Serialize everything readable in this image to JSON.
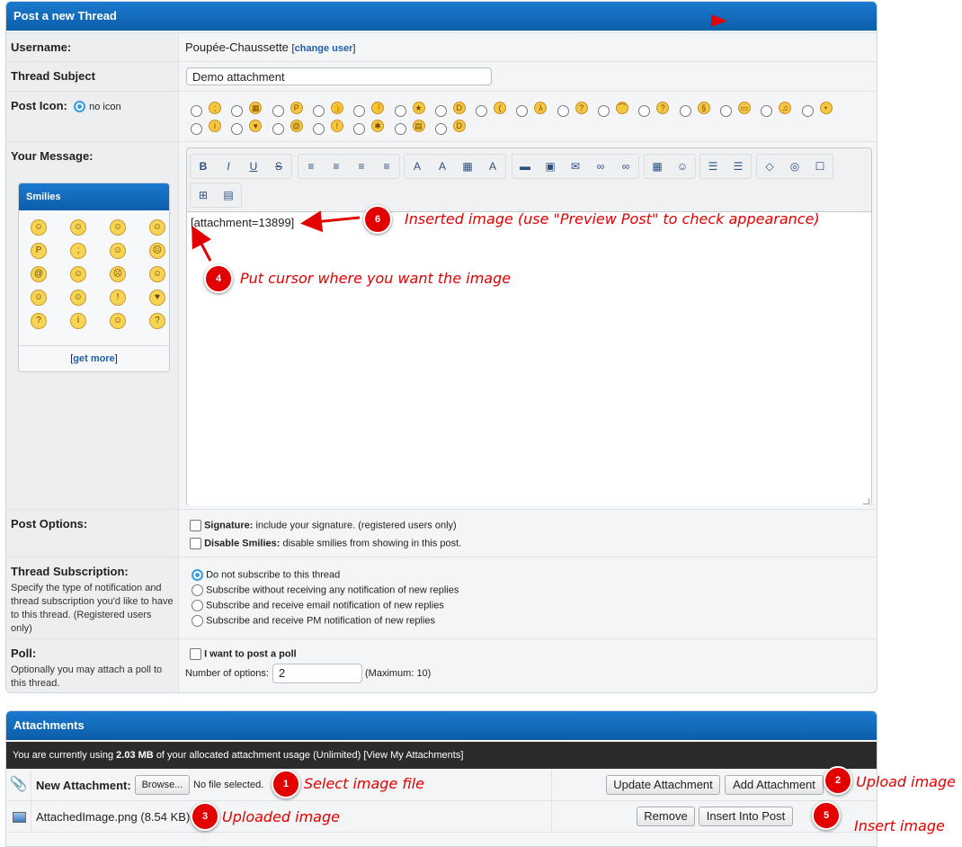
{
  "post_panel": {
    "title": "Post a new Thread",
    "username_label": "Username:",
    "username_value": "Poupée-Chaussette",
    "change_user_open": "[",
    "change_user_link": "change user",
    "change_user_close": "]",
    "subject_label": "Thread Subject",
    "subject_value": "Demo attachment",
    "post_icon_label": "Post Icon:",
    "no_icon_label": "no icon",
    "message_label": "Your Message:",
    "message_text": "[attachment=13899]",
    "smilies_title": "Smilies",
    "get_more_open": "[",
    "get_more_link": "get more",
    "get_more_close": "]",
    "post_options_label": "Post Options:",
    "signature_bold": "Signature:",
    "signature_text": "include your signature. (registered users only)",
    "disable_smilies_bold": "Disable Smilies:",
    "disable_smilies_text": "disable smilies from showing in this post.",
    "subscription_label": "Thread Subscription:",
    "subscription_desc": "Specify the type of notification and thread subscription you'd like to have to this thread. (Registered users only)",
    "subscription_options": [
      "Do not subscribe to this thread",
      "Subscribe without receiving any notification of new replies",
      "Subscribe and receive email notification of new replies",
      "Subscribe and receive PM notification of new replies"
    ],
    "poll_label": "Poll:",
    "poll_desc": "Optionally you may attach a poll to this thread.",
    "poll_checkbox": "I want to post a poll",
    "num_options_label": "Number of options:",
    "num_options_value": "2",
    "num_options_max": "(Maximum: 10)"
  },
  "attachments_panel": {
    "title": "Attachments",
    "usage_prefix": "You are currently using",
    "usage_amount": "2.03 MB",
    "usage_suffix": "of your allocated attachment usage (Unlimited)",
    "view_link": "[View My Attachments]",
    "new_attachment_label": "New Attachment:",
    "browse_button": "Browse...",
    "no_file": "No file selected.",
    "update_button": "Update Attachment",
    "add_button": "Add Attachment",
    "file_name": "AttachedImage.png (8.54 KB)",
    "remove_button": "Remove",
    "insert_button": "Insert Into Post"
  },
  "annotations": {
    "n1": "1",
    "t1": "Select image file",
    "n2": "2",
    "t2": "Upload image",
    "n3": "3",
    "t3": "Uploaded image",
    "n4": "4",
    "t4": "Put cursor where you want the image",
    "n5": "5",
    "t5": "Insert image",
    "n6": "6",
    "t6": "Inserted image (use \"Preview Post\" to check appearance)"
  },
  "colors": {
    "header_blue": "#1169bd",
    "annotation_red": "#e30000",
    "attachment_bar": "#2b2b2b"
  }
}
